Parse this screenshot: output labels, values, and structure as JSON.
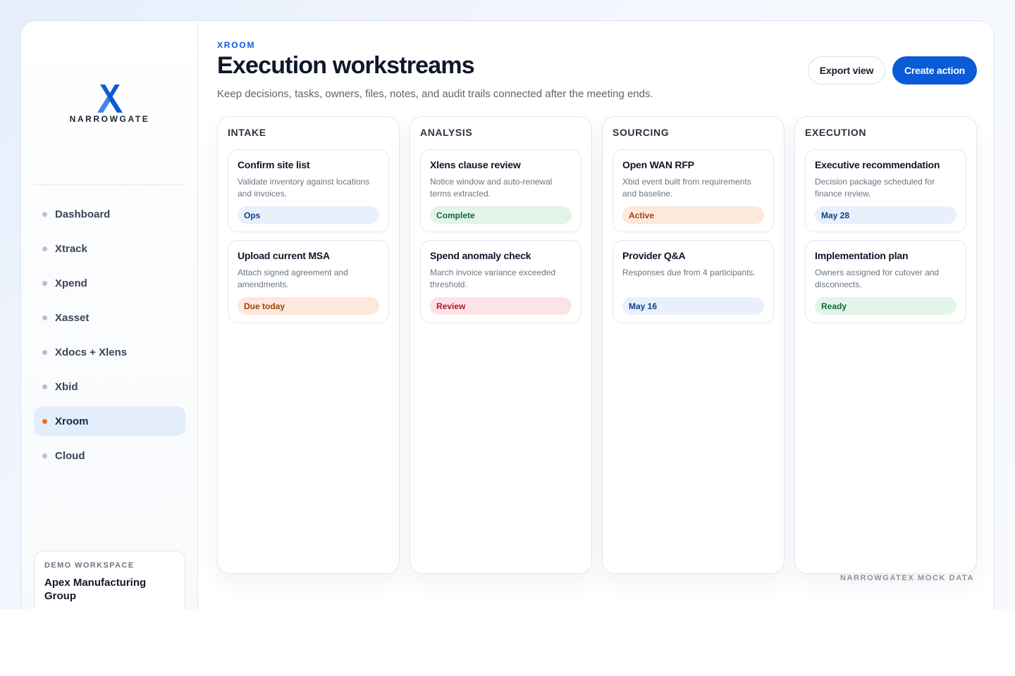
{
  "brand": {
    "name": "NARROWGATE",
    "accent": "#0b5bd7",
    "highlight": "#f26b1d"
  },
  "sidebar": {
    "items": [
      {
        "label": "Dashboard",
        "active": false
      },
      {
        "label": "Xtrack",
        "active": false
      },
      {
        "label": "Xpend",
        "active": false
      },
      {
        "label": "Xasset",
        "active": false
      },
      {
        "label": "Xdocs + Xlens",
        "active": false
      },
      {
        "label": "Xbid",
        "active": false
      },
      {
        "label": "Xroom",
        "active": true
      },
      {
        "label": "Cloud",
        "active": false
      }
    ],
    "workspace": {
      "label": "DEMO WORKSPACE",
      "name": "Apex Manufacturing Group"
    }
  },
  "header": {
    "eyebrow": "XROOM",
    "title": "Execution workstreams",
    "subtitle": "Keep decisions, tasks, owners, files, notes, and audit trails connected after the meeting ends.",
    "export_label": "Export view",
    "create_label": "Create action"
  },
  "board": {
    "columns": [
      {
        "title": "INTAKE",
        "cards": [
          {
            "title": "Confirm site list",
            "desc": "Validate inventory against locations and invoices.",
            "tag": "Ops",
            "tone": "blue"
          },
          {
            "title": "Upload current MSA",
            "desc": "Attach signed agreement and amendments.",
            "tag": "Due today",
            "tone": "orange"
          }
        ]
      },
      {
        "title": "ANALYSIS",
        "cards": [
          {
            "title": "Xlens clause review",
            "desc": "Notice window and auto-renewal terms extracted.",
            "tag": "Complete",
            "tone": "green"
          },
          {
            "title": "Spend anomaly check",
            "desc": "March invoice variance exceeded threshold.",
            "tag": "Review",
            "tone": "red"
          }
        ]
      },
      {
        "title": "SOURCING",
        "cards": [
          {
            "title": "Open WAN RFP",
            "desc": "Xbid event built from requirements and baseline.",
            "tag": "Active",
            "tone": "orange"
          },
          {
            "title": "Provider Q&A",
            "desc": "Responses due from 4 participants.",
            "tag": "May 16",
            "tone": "blue"
          }
        ]
      },
      {
        "title": "EXECUTION",
        "cards": [
          {
            "title": "Executive recommendation",
            "desc": "Decision package scheduled for finance review.",
            "tag": "May 28",
            "tone": "blue"
          },
          {
            "title": "Implementation plan",
            "desc": "Owners assigned for cutover and disconnects.",
            "tag": "Ready",
            "tone": "green"
          }
        ]
      }
    ]
  },
  "footer": {
    "watermark": "NARROWGATEX MOCK DATA"
  }
}
